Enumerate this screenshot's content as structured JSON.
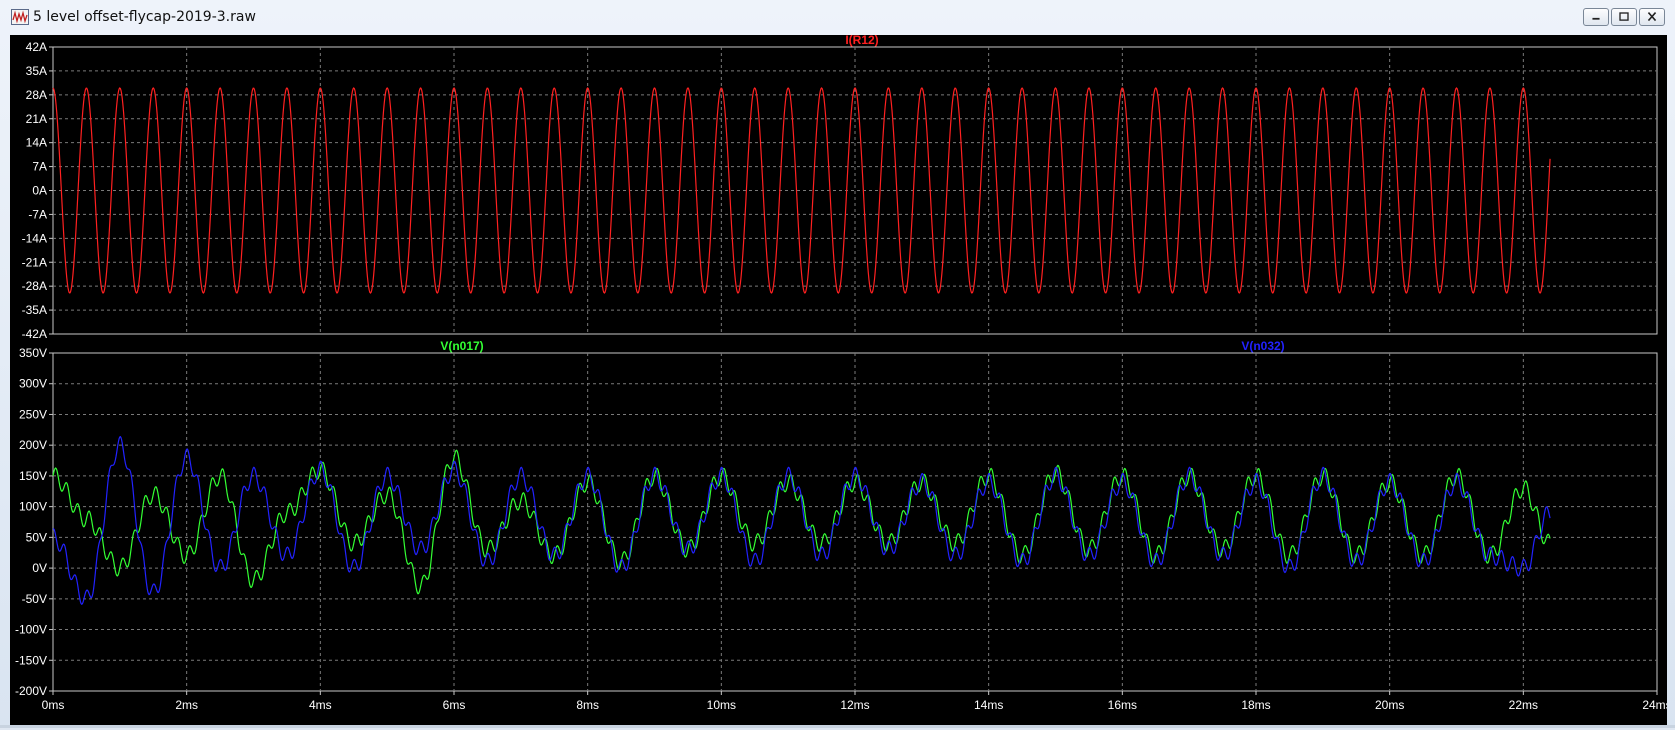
{
  "window": {
    "title": "5 level offset-flycap-2019-3.raw",
    "buttons": [
      "minimize",
      "maximize",
      "close"
    ]
  },
  "colors": {
    "background": "#000000",
    "grid": "#7a7a7a",
    "axis_text": "#ffffff",
    "i_r12": "#ff2020",
    "v_n017": "#33ff33",
    "v_n032": "#2222ff"
  },
  "chart_data": [
    {
      "type": "line",
      "title": "",
      "series": [
        {
          "name": "I(R12)",
          "color": "#ff2020",
          "amplitude": 30,
          "frequency_hz": 2000,
          "phase_deg": 90,
          "x_end_ms": 22.4
        }
      ],
      "xlabel": "",
      "ylabel": "",
      "xlim": [
        0,
        24
      ],
      "ylim": [
        -42,
        42
      ],
      "y_ticks": [
        "42A",
        "35A",
        "28A",
        "21A",
        "14A",
        "7A",
        "0A",
        "-7A",
        "-14A",
        "-21A",
        "-28A",
        "-35A",
        "-42A"
      ],
      "y_tick_values": [
        42,
        35,
        28,
        21,
        14,
        7,
        0,
        -7,
        -14,
        -21,
        -28,
        -35,
        -42
      ],
      "grid": true
    },
    {
      "type": "line",
      "title": "",
      "series": [
        {
          "name": "V(n017)",
          "color": "#33ff33",
          "x_end_ms": 22.4,
          "x": [
            0,
            0.5,
            1,
            1.5,
            2,
            2.5,
            3,
            3.5,
            4,
            4.5,
            5,
            5.5,
            6,
            6.5,
            7,
            7.5,
            8,
            8.5,
            9,
            9.5,
            10,
            10.5,
            11,
            11.5,
            12,
            12.5,
            13,
            13.5,
            14,
            14.5,
            15,
            15.5,
            16,
            16.5,
            17,
            17.5,
            18,
            18.5,
            19,
            19.5,
            20,
            20.5,
            21,
            21.5,
            22,
            22.4
          ],
          "y": [
            150,
            80,
            0,
            120,
            20,
            150,
            -20,
            90,
            160,
            40,
            120,
            -30,
            180,
            30,
            110,
            20,
            140,
            10,
            150,
            30,
            150,
            40,
            140,
            40,
            140,
            40,
            140,
            40,
            150,
            20,
            155,
            30,
            150,
            20,
            150,
            30,
            150,
            20,
            150,
            20,
            140,
            20,
            150,
            20,
            130,
            40
          ]
        },
        {
          "name": "V(n032)",
          "color": "#2222ff",
          "x_end_ms": 22.4,
          "x": [
            0,
            0.5,
            1,
            1.5,
            2,
            2.5,
            3,
            3.5,
            4,
            4.5,
            5,
            5.5,
            6,
            6.5,
            7,
            7.5,
            8,
            8.5,
            9,
            9.5,
            10,
            10.5,
            11,
            11.5,
            12,
            12.5,
            13,
            13.5,
            14,
            14.5,
            15,
            15.5,
            16,
            16.5,
            17,
            17.5,
            18,
            18.5,
            19,
            19.5,
            20,
            20.5,
            21,
            21.5,
            22,
            22.4
          ],
          "y": [
            50,
            -50,
            200,
            -40,
            180,
            0,
            150,
            20,
            160,
            0,
            150,
            30,
            160,
            10,
            150,
            20,
            150,
            0,
            150,
            30,
            150,
            10,
            150,
            20,
            150,
            30,
            140,
            20,
            140,
            10,
            150,
            20,
            140,
            10,
            150,
            20,
            140,
            0,
            150,
            10,
            140,
            10,
            140,
            20,
            0,
            90
          ]
        }
      ],
      "xlabel": "",
      "ylabel": "",
      "xlim": [
        0,
        24
      ],
      "ylim": [
        -200,
        350
      ],
      "y_ticks": [
        "350V",
        "300V",
        "250V",
        "200V",
        "150V",
        "100V",
        "50V",
        "0V",
        "-50V",
        "-100V",
        "-150V",
        "-200V"
      ],
      "y_tick_values": [
        350,
        300,
        250,
        200,
        150,
        100,
        50,
        0,
        -50,
        -100,
        -150,
        -200
      ],
      "x_ticks": [
        "0ms",
        "2ms",
        "4ms",
        "6ms",
        "8ms",
        "10ms",
        "12ms",
        "14ms",
        "16ms",
        "18ms",
        "20ms",
        "22ms",
        "24ms"
      ],
      "x_tick_values": [
        0,
        2,
        4,
        6,
        8,
        10,
        12,
        14,
        16,
        18,
        20,
        22,
        24
      ],
      "grid": true
    }
  ]
}
